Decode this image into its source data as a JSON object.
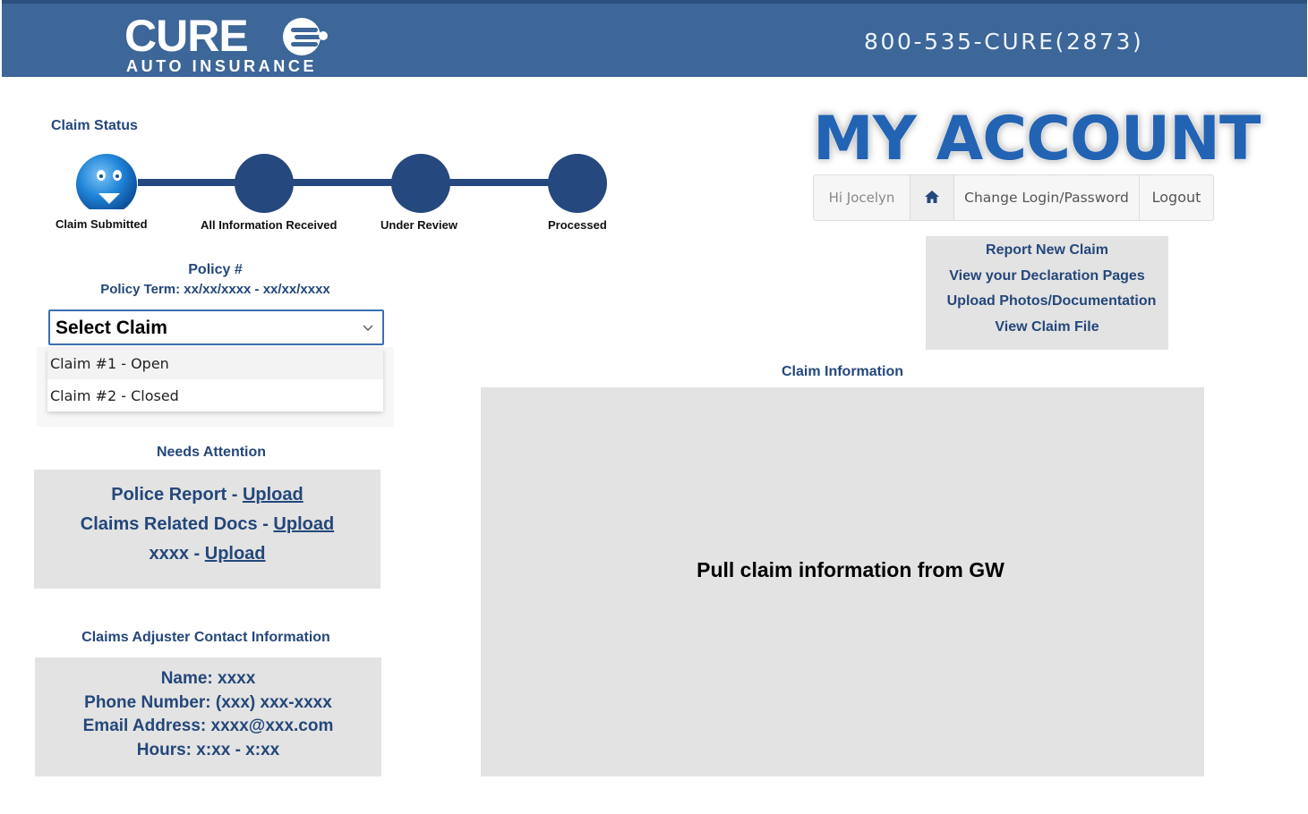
{
  "header": {
    "logo_word": "CURE",
    "logo_sub": "AUTO INSURANCE",
    "phone": "800-535-CURE(2873)"
  },
  "claim_status": {
    "title": "Claim Status",
    "steps": [
      {
        "label": "Claim Submitted",
        "current": true
      },
      {
        "label": "All Information Received",
        "current": false
      },
      {
        "label": "Under Review",
        "current": false
      },
      {
        "label": "Processed",
        "current": false
      }
    ]
  },
  "policy": {
    "number_label": "Policy #",
    "term": "Policy Term: xx/xx/xxxx - xx/xx/xxxx"
  },
  "claim_select": {
    "value": "Select Claim",
    "options": [
      "Claim #1 - Open",
      "Claim #2 - Closed"
    ]
  },
  "needs_attention": {
    "title": "Needs Attention",
    "items": [
      {
        "name": "Police Report -",
        "action": "Upload"
      },
      {
        "name": "Claims Related Docs -",
        "action": "Upload"
      },
      {
        "name": "xxxx -",
        "action": "Upload"
      }
    ]
  },
  "adjuster": {
    "title": "Claims Adjuster Contact Information",
    "lines": [
      "Name: xxxx",
      "Phone Number: (xxx) xxx-xxxx",
      "Email Address: xxxx@xxx.com",
      "Hours: x:xx - x:xx"
    ]
  },
  "account": {
    "heading": "MY ACCOUNT",
    "nav": {
      "greeting": "Hi Jocelyn",
      "home_icon": "home-icon",
      "change_login": "Change Login/Password",
      "logout": "Logout"
    },
    "quick_links": [
      "Report New Claim",
      "View your Declaration Pages",
      "Upload Photos/Documentation",
      "View Claim File"
    ]
  },
  "claim_information": {
    "title": "Claim Information",
    "body": "Pull claim information from GW"
  },
  "colors": {
    "header_bg": "#3d6699",
    "brand_navy": "#24477a",
    "tracker": "#25487e",
    "panel_bg": "#e3e3e3",
    "heading_blue": "#2363b3"
  }
}
